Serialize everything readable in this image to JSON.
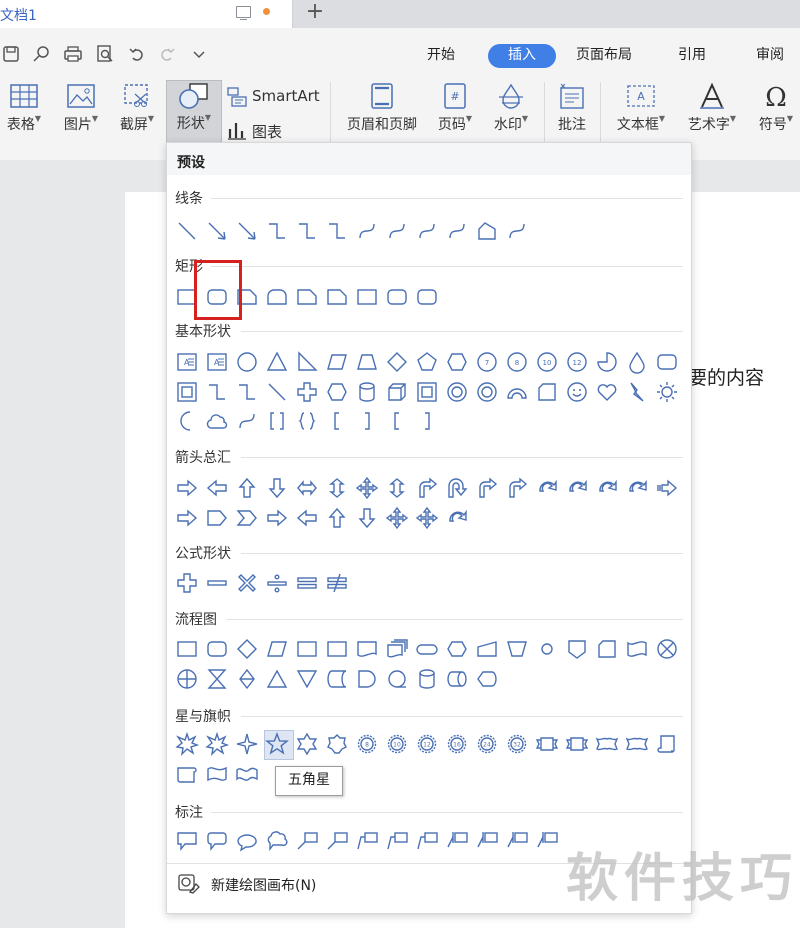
{
  "titlebar": {
    "doc_name": "文档1",
    "new_tab": "+"
  },
  "menu_tabs": [
    "开始",
    "插入",
    "页面布局",
    "引用",
    "审阅"
  ],
  "toolbar": {
    "table": "表格",
    "picture": "图片",
    "screenshot": "截屏",
    "shape": "形状",
    "smartart": "SmartArt",
    "chart": "图表",
    "header_footer": "页眉和页脚",
    "page_number": "页码",
    "watermark": "水印",
    "comment": "批注",
    "textbox": "文本框",
    "wordart": "艺术字",
    "symbol": "符号"
  },
  "page": {
    "text": "要的内容"
  },
  "overlay_watermark": "软件技巧",
  "panel": {
    "title": "预设",
    "sections": [
      "线条",
      "矩形",
      "基本形状",
      "箭头总汇",
      "公式形状",
      "流程图",
      "星与旗帜",
      "标注"
    ],
    "new_canvas": "新建绘图画布(N)",
    "tooltip": "五角星"
  },
  "colors": {
    "accent": "#3f7fe6",
    "shape_stroke": "#4a70b4",
    "highlight": "#d6221e"
  }
}
